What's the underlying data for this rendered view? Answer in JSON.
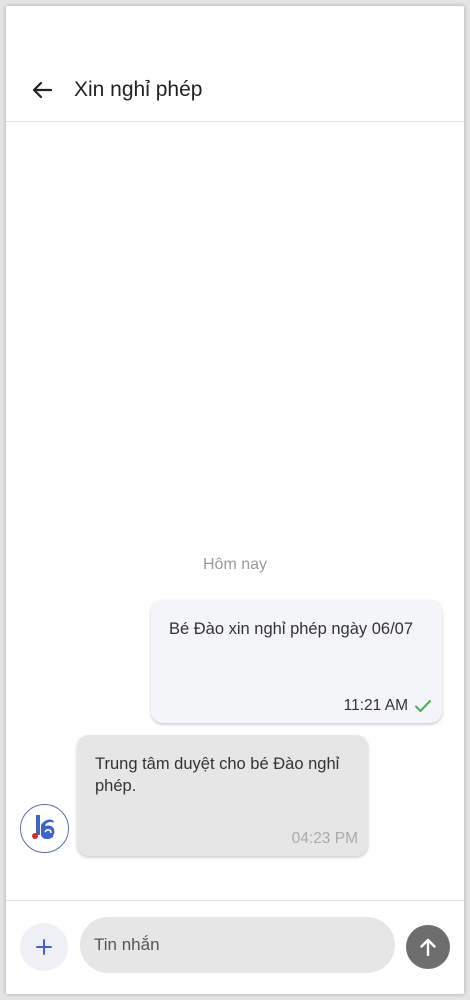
{
  "header": {
    "title": "Xin nghỉ phép",
    "back_icon": "arrow-left-icon"
  },
  "chat": {
    "date_separator": "Hôm nay",
    "messages": [
      {
        "direction": "outgoing",
        "text": "Bé Đào xin nghỉ phép ngày 06/07",
        "time": "11:21 AM",
        "status_icon": "check-icon",
        "status_color": "#4caf50"
      },
      {
        "direction": "incoming",
        "text": "Trung tâm duyệt cho bé Đào nghỉ phép.",
        "time": "04:23 PM",
        "avatar_icon": "school-logo-icon"
      }
    ]
  },
  "composer": {
    "add_icon": "plus-icon",
    "placeholder": "Tin nhắn",
    "send_icon": "arrow-up-icon"
  },
  "colors": {
    "accent": "#3f63c7",
    "outgoing_bubble": "#f4f5f9",
    "incoming_bubble": "#e6e6e6",
    "send_button": "#6e6e6e"
  }
}
